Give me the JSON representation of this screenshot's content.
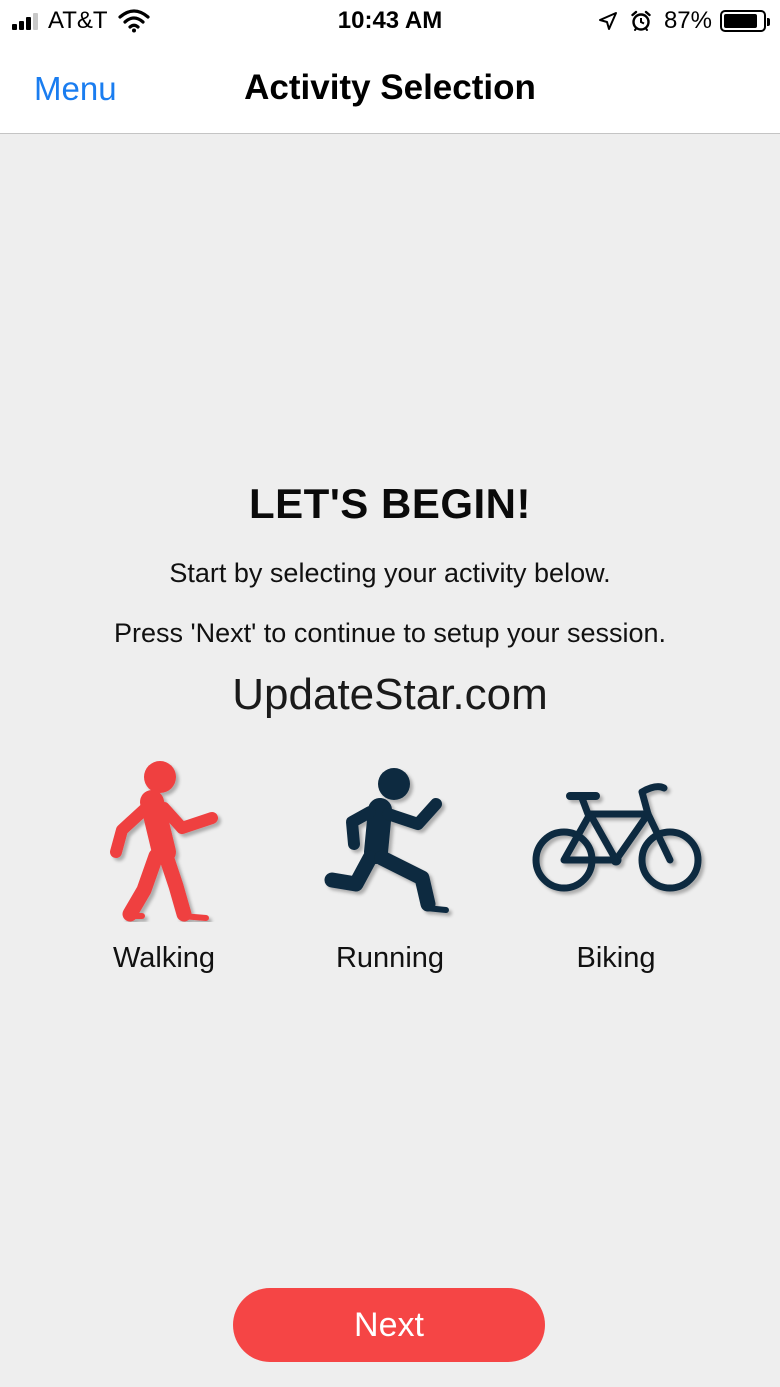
{
  "status_bar": {
    "carrier": "AT&T",
    "time": "10:43 AM",
    "battery_percent": "87%",
    "battery_level": 0.87,
    "icons": [
      "signal-icon",
      "wifi-icon",
      "location-arrow-icon",
      "alarm-icon",
      "battery-icon"
    ]
  },
  "nav": {
    "menu_label": "Menu",
    "title": "Activity Selection"
  },
  "content": {
    "headline": "LET'S BEGIN!",
    "line1": "Start by selecting your activity below.",
    "line2": "Press 'Next' to continue to setup your session.",
    "watermark": "UpdateStar.com"
  },
  "activities": [
    {
      "label": "Walking",
      "icon": "walking-person-icon",
      "selected": true
    },
    {
      "label": "Running",
      "icon": "running-person-icon",
      "selected": false
    },
    {
      "label": "Biking",
      "icon": "bicycle-icon",
      "selected": false
    }
  ],
  "colors": {
    "accent_blue": "#1a7df0",
    "selected_red": "#ef4040",
    "icon_navy": "#0f2a3f",
    "button_red": "#f54545",
    "background": "#eeeeee"
  },
  "next_button": {
    "label": "Next"
  }
}
